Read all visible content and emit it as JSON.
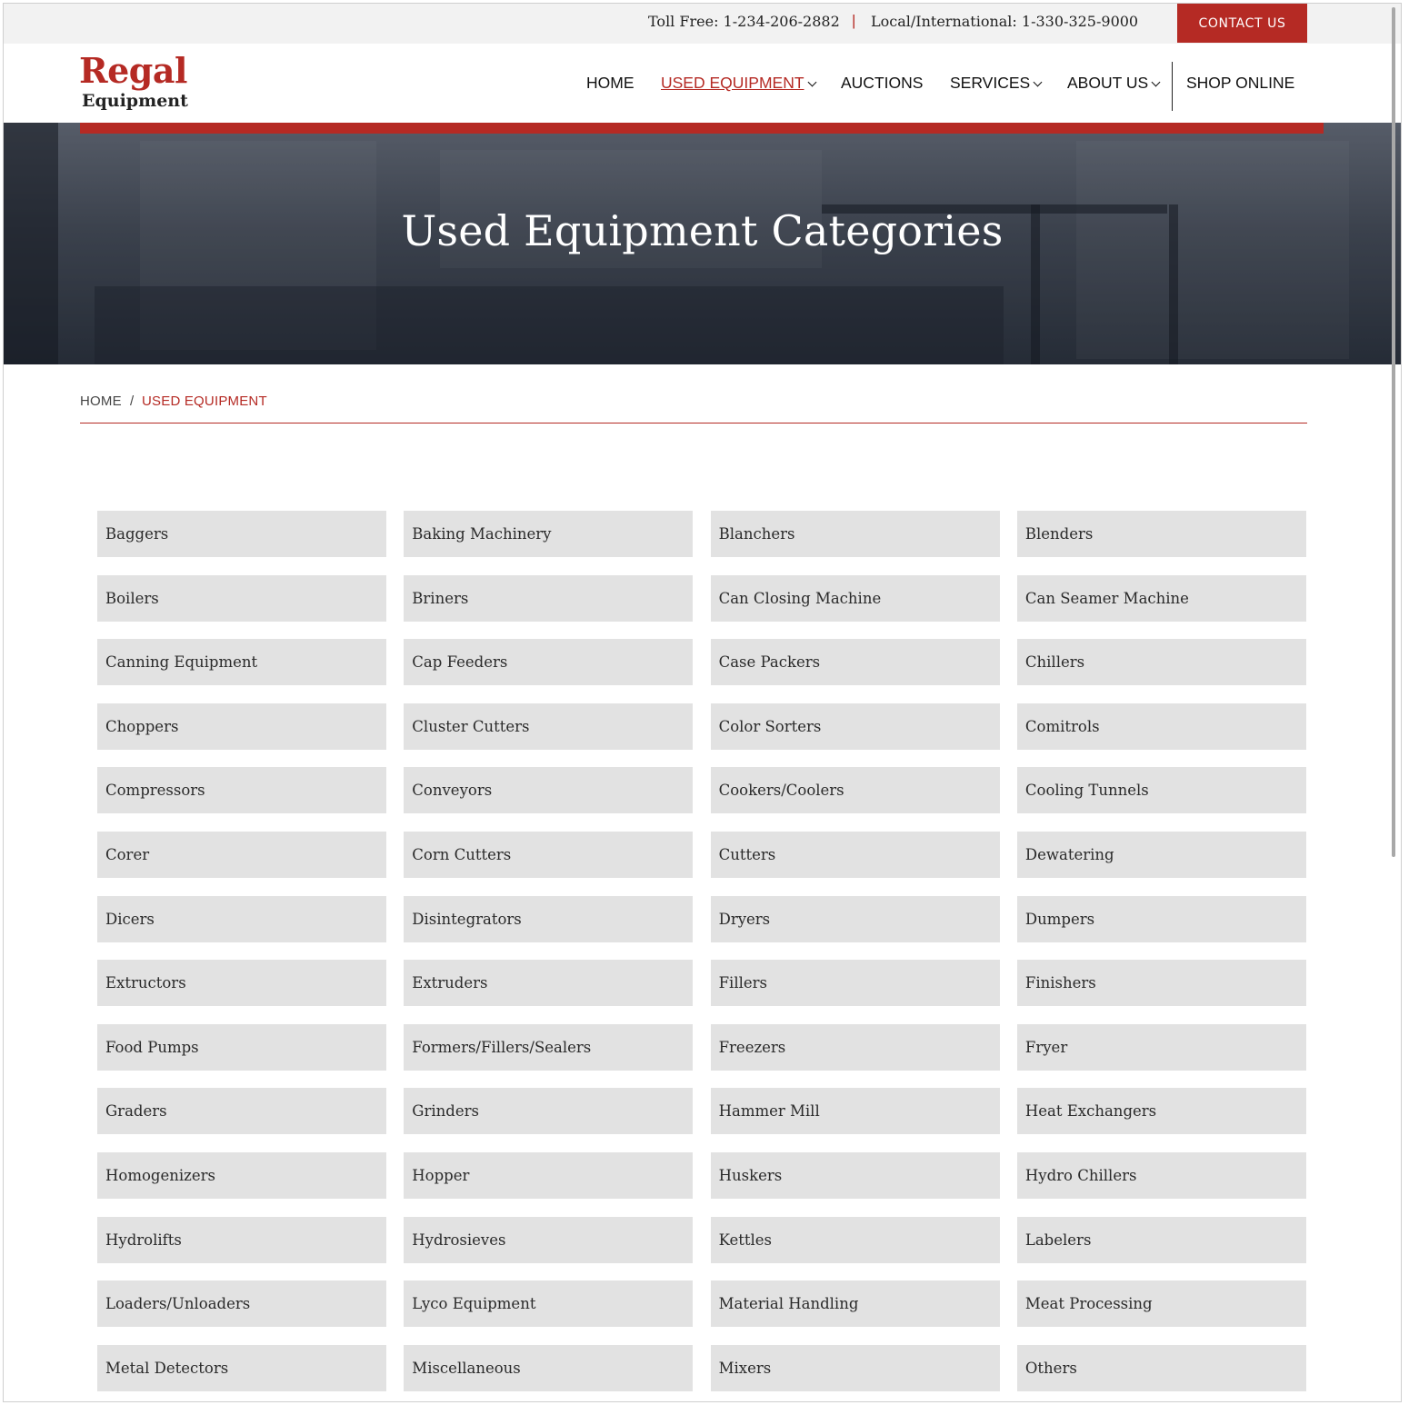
{
  "topbar": {
    "toll_free_label": "Toll Free:",
    "toll_free_number": "1-234-206-2882",
    "separator": "|",
    "local_label": "Local/International:",
    "local_number": "1-330-325-9000",
    "contact_label": "CONTACT US"
  },
  "brand": {
    "line1": "Regal",
    "line2": "Equipment",
    "color": "#b52a24"
  },
  "nav": {
    "items": [
      {
        "label": "HOME",
        "active": false,
        "dropdown": false
      },
      {
        "label": "USED EQUIPMENT",
        "active": true,
        "dropdown": true
      },
      {
        "label": "AUCTIONS",
        "active": false,
        "dropdown": false
      },
      {
        "label": "SERVICES",
        "active": false,
        "dropdown": true
      },
      {
        "label": "ABOUT US",
        "active": false,
        "dropdown": true
      },
      {
        "label": "SHOP ONLINE",
        "active": false,
        "dropdown": false
      }
    ]
  },
  "hero": {
    "title": "Used Equipment Categories"
  },
  "breadcrumb": {
    "home": "HOME",
    "separator": "/",
    "current": "USED EQUIPMENT"
  },
  "categories": [
    "Baggers",
    "Baking Machinery",
    "Blanchers",
    "Blenders",
    "Boilers",
    "Briners",
    "Can Closing Machine",
    "Can Seamer Machine",
    "Canning Equipment",
    "Cap Feeders",
    "Case Packers",
    "Chillers",
    "Choppers",
    "Cluster Cutters",
    "Color Sorters",
    "Comitrols",
    "Compressors",
    "Conveyors",
    "Cookers/Coolers",
    "Cooling Tunnels",
    "Corer",
    "Corn Cutters",
    "Cutters",
    "Dewatering",
    "Dicers",
    "Disintegrators",
    "Dryers",
    "Dumpers",
    "Extructors",
    "Extruders",
    "Fillers",
    "Finishers",
    "Food Pumps",
    "Formers/Fillers/Sealers",
    "Freezers",
    "Fryer",
    "Graders",
    "Grinders",
    "Hammer Mill",
    "Heat Exchangers",
    "Homogenizers",
    "Hopper",
    "Huskers",
    "Hydro Chillers",
    "Hydrolifts",
    "Hydrosieves",
    "Kettles",
    "Labelers",
    "Loaders/Unloaders",
    "Lyco Equipment",
    "Material Handling",
    "Meat Processing",
    "Metal Detectors",
    "Miscellaneous",
    "Mixers",
    "Others"
  ],
  "colors": {
    "accent": "#b52a24",
    "tile_bg": "#e2e2e2",
    "topbar_bg": "#f2f2f2"
  }
}
